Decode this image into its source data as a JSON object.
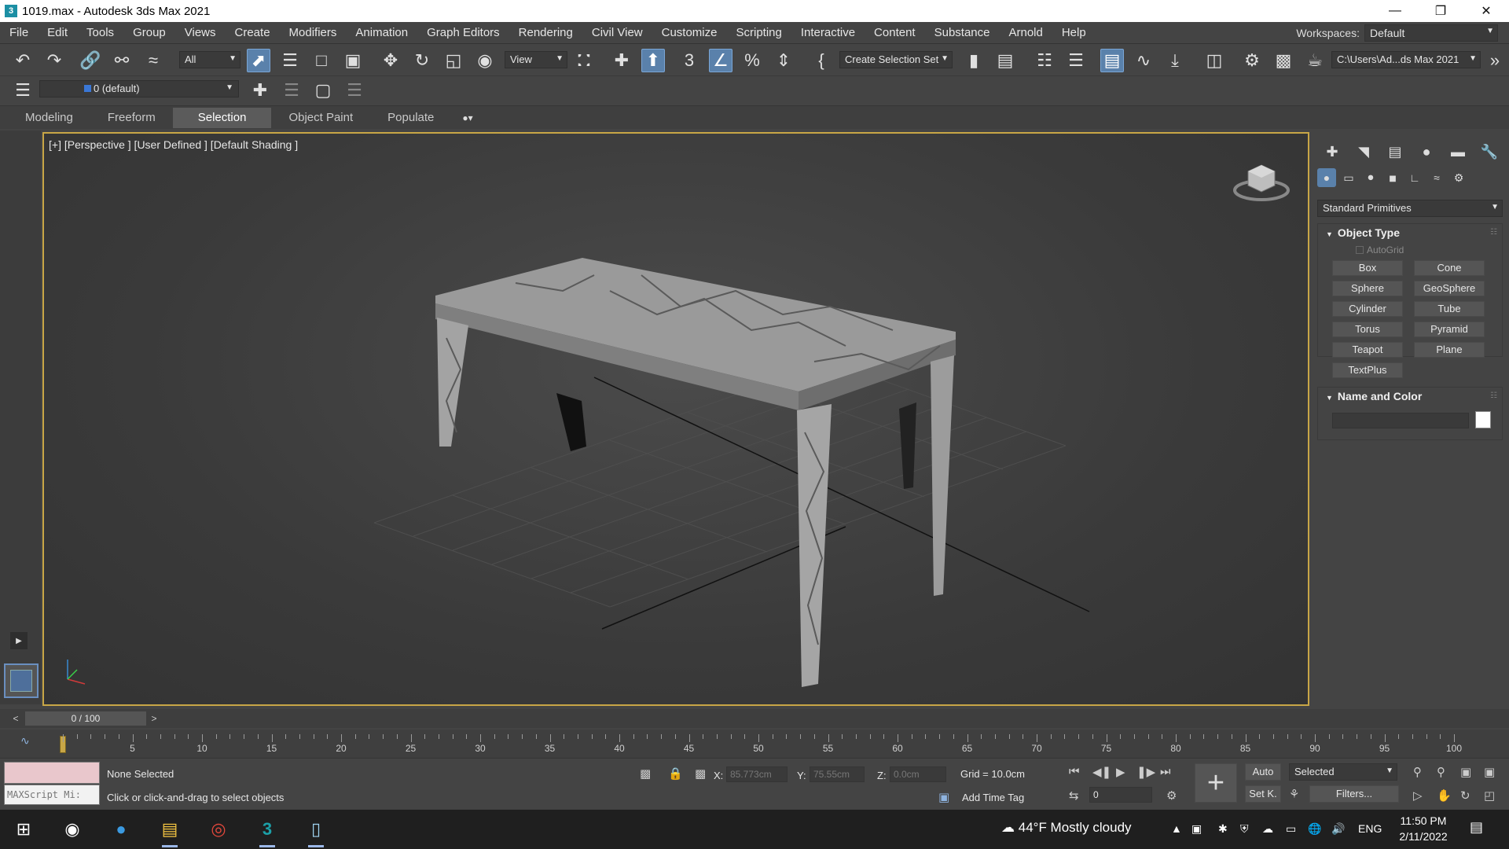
{
  "window": {
    "title": "1019.max - Autodesk 3ds Max 2021",
    "app_icon": "3"
  },
  "menu": {
    "items": [
      "File",
      "Edit",
      "Tools",
      "Group",
      "Views",
      "Create",
      "Modifiers",
      "Animation",
      "Graph Editors",
      "Rendering",
      "Civil View",
      "Customize",
      "Scripting",
      "Interactive",
      "Content",
      "Substance",
      "Arnold",
      "Help"
    ],
    "workspaces_label": "Workspaces:",
    "workspace_value": "Default"
  },
  "toolbar": {
    "filter_value": "All",
    "ref_coord_value": "View",
    "selection_set_value": "Create Selection Set",
    "project_path": "C:\\Users\\Ad...ds Max 2021"
  },
  "toolbar2": {
    "layer_value": "0 (default)"
  },
  "ribbon": {
    "tabs": [
      "Modeling",
      "Freeform",
      "Selection",
      "Object Paint",
      "Populate"
    ],
    "active_tab": "Selection"
  },
  "viewport": {
    "label": "[+] [Perspective ] [User Defined ] [Default Shading ]"
  },
  "command_panel": {
    "category": "Standard Primitives",
    "object_type_title": "Object Type",
    "autogrid_label": "AutoGrid",
    "buttons": [
      "Box",
      "Cone",
      "Sphere",
      "GeoSphere",
      "Cylinder",
      "Tube",
      "Torus",
      "Pyramid",
      "Teapot",
      "Plane",
      "TextPlus"
    ],
    "name_color_title": "Name and Color",
    "object_color": "#ffffff"
  },
  "timeline": {
    "frame_display": "0 / 100",
    "prev": "<",
    "next": ">",
    "ticks": [
      "0",
      "5",
      "10",
      "15",
      "20",
      "25",
      "30",
      "35",
      "40",
      "45",
      "50",
      "55",
      "60",
      "65",
      "70",
      "75",
      "80",
      "85",
      "90",
      "95",
      "100"
    ]
  },
  "status": {
    "maxscript_label": "MAXScript Mi:",
    "selection_status": "None Selected",
    "prompt": "Click or click-and-drag to select objects",
    "x_label": "X:",
    "x_value": "85.773cm",
    "y_label": "Y:",
    "y_value": "75.55cm",
    "z_label": "Z:",
    "z_value": "0.0cm",
    "grid": "Grid = 10.0cm",
    "add_time_tag": "Add Time Tag",
    "auto_label": "Auto",
    "selected_value": "Selected",
    "set_key_label": "Set K.",
    "filters_label": "Filters...",
    "frame_field": "0"
  },
  "taskbar": {
    "weather": "44°F  Mostly cloudy",
    "lang": "ENG",
    "time": "11:50 PM",
    "date": "2/11/2022"
  }
}
